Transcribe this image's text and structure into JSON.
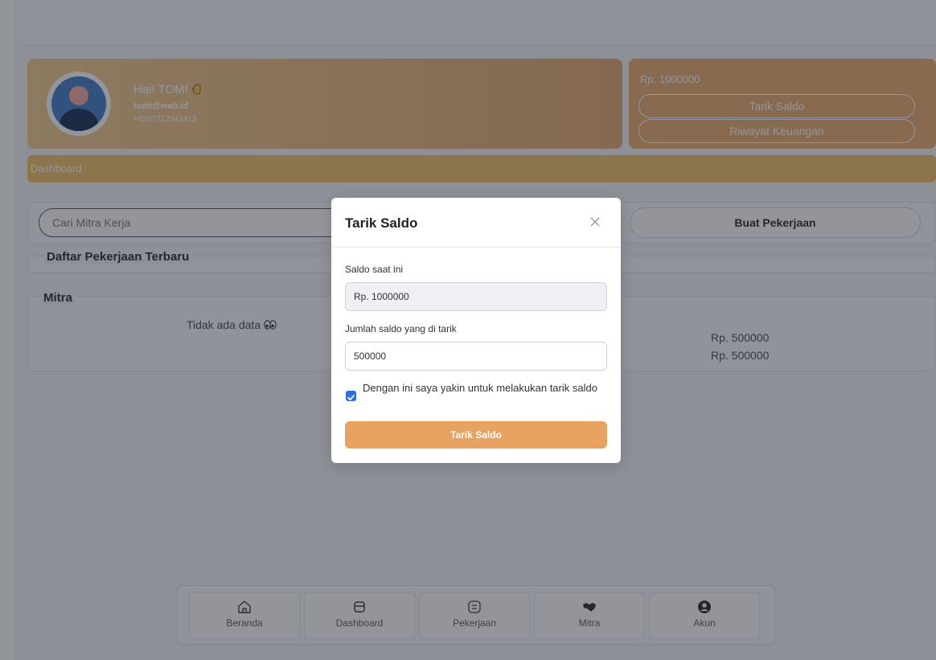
{
  "profile": {
    "greeting": "Hai! TOMI",
    "wave_icon": "waving-hand-icon",
    "email": "tomi@web.id",
    "phone": "+6287712342413"
  },
  "balance_card": {
    "amount": "Rp. 1000000",
    "tarik_saldo_label": "Tarik Saldo",
    "riwayat_label": "Riwayat Keuangan"
  },
  "breadcrumb": "Dashboard",
  "search": {
    "placeholder": "Cari Mitra Kerja"
  },
  "buat_pekerjaan_label": "Buat Pekerjaan",
  "sections": {
    "recent_jobs_title": "Daftar Pekerjaan Terbaru",
    "mitra_title": "Mitra",
    "no_data": "Tidak ada data",
    "amounts": [
      "Rp. 500000",
      "Rp. 500000"
    ]
  },
  "bottom_nav": [
    {
      "label": "Beranda",
      "icon": "home-icon"
    },
    {
      "label": "Dashboard",
      "icon": "dashboard-icon"
    },
    {
      "label": "Pekerjaan",
      "icon": "clipboard-icon"
    },
    {
      "label": "Mitra",
      "icon": "handshake-icon"
    },
    {
      "label": "Akun",
      "icon": "user-circle-icon"
    }
  ],
  "modal": {
    "title": "Tarik Saldo",
    "current_label": "Saldo saat ini",
    "current_value": "Rp. 1000000",
    "amount_label": "Jumlah saldo yang di tarik",
    "amount_value": "500000",
    "confirm_text": "Dengan ini saya yakin untuk melakukan tarik saldo",
    "confirm_checked": true,
    "submit_label": "Tarik Saldo"
  },
  "colors": {
    "accent": "#E8A262",
    "checkbox": "#2F6FD6"
  }
}
